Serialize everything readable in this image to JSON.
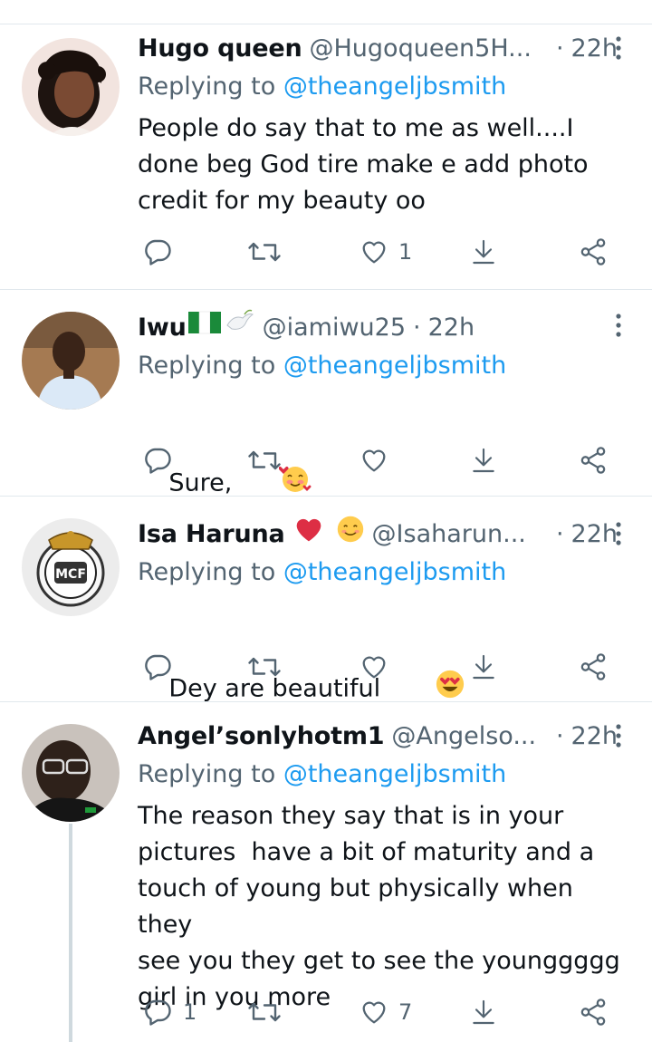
{
  "replying_label": "Replying to",
  "tweets": [
    {
      "name": "Hugo queen",
      "handle": "@Hugoqueen5H...",
      "time": "22h",
      "replying_to": "@theangeljbsmith",
      "text": "People do say that to me as well....I\ndone beg God tire make e add photo\ncredit for my beauty oo",
      "reply_count": "",
      "retweet_count": "",
      "like_count": "1",
      "avatar_color": "#d9b8a8"
    },
    {
      "name": "Iwu",
      "handle": "@iamiwu25",
      "time": "22h",
      "replying_to": "@theangeljbsmith",
      "text": "Sure,",
      "reply_count": "",
      "retweet_count": "",
      "like_count": "",
      "avatar_color": "#8a6a4a"
    },
    {
      "name": "Isa Haruna",
      "handle": "@Isaharun...",
      "time": "22h",
      "replying_to": "@theangeljbsmith",
      "text": "Dey are beautiful ",
      "reply_count": "",
      "retweet_count": "",
      "like_count": "",
      "avatar_color": "#e8e8e8"
    },
    {
      "name": "Angel’sonlyhotm1",
      "handle": "@Angelso...",
      "time": "22h",
      "replying_to": "@theangeljbsmith",
      "text": "The reason they say that is in your\npictures  have a bit of maturity and a\ntouch of young but physically when they\nsee you they get to see the younggggg\ngirl in you more",
      "reply_count": "1",
      "retweet_count": "",
      "like_count": "7",
      "avatar_color": "#3a2e28"
    }
  ],
  "colors": {
    "text": "#0f1419",
    "secondary": "#536471",
    "link": "#1d9bf0",
    "divider": "#e1e8ed",
    "heart_red": "#e0245e"
  }
}
